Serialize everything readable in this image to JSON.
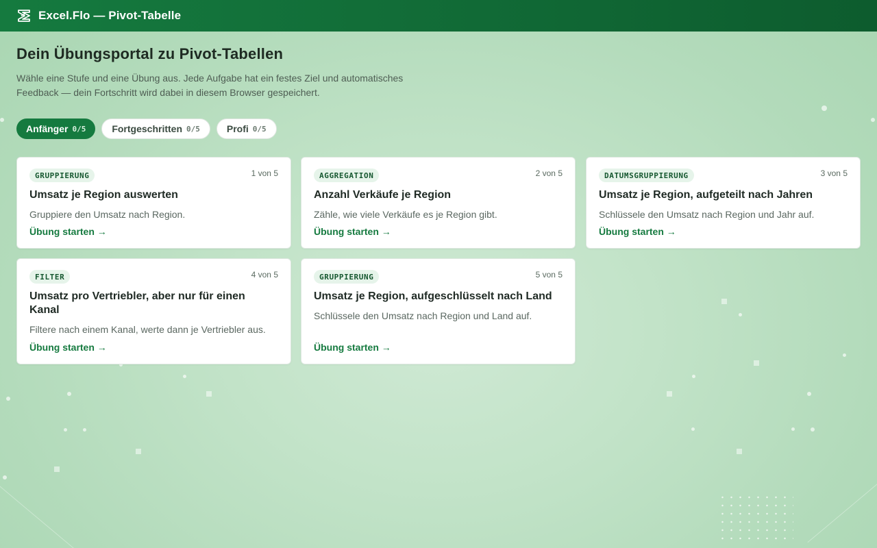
{
  "header": {
    "app_title": "Excel.Flo — Pivot-Tabelle",
    "logo_icon": "leaf-logo-icon"
  },
  "intro": {
    "title": "Dein Übungsportal zu Pivot-Tabellen",
    "description": "Wähle eine Stufe und eine Übung aus. Jede Aufgabe hat ein festes Ziel und automatisches Feedback — dein Fortschritt wird dabei in diesem Browser gespeichert."
  },
  "tabs": [
    {
      "label": "Anfänger",
      "count": "0/5",
      "active": true
    },
    {
      "label": "Fortgeschritten",
      "count": "0/5",
      "active": false
    },
    {
      "label": "Profi",
      "count": "0/5",
      "active": false
    }
  ],
  "exercises": [
    {
      "badge": "GRUPPIERUNG",
      "counter": "1 von 5",
      "title": "Umsatz je Region auswerten",
      "description": "Gruppiere den Umsatz nach Region.",
      "link": "Übung starten →"
    },
    {
      "badge": "AGGREGATION",
      "counter": "2 von 5",
      "title": "Anzahl Verkäufe je Region",
      "description": "Zähle, wie viele Verkäufe es je Region gibt.",
      "link": "Übung starten →"
    },
    {
      "badge": "DATUMSGRUPPIERUNG",
      "counter": "3 von 5",
      "title": "Umsatz je Region, aufgeteilt nach Jahren",
      "description": "Schlüssele den Umsatz nach Region und Jahr auf.",
      "link": "Übung starten →"
    },
    {
      "badge": "FILTER",
      "counter": "4 von 5",
      "title": "Umsatz pro Vertriebler, aber nur für einen Kanal",
      "description": "Filtere nach einem Kanal, werte dann je Vertriebler aus.",
      "link": "Übung starten →"
    },
    {
      "badge": "GRUPPIERUNG",
      "counter": "5 von 5",
      "title": "Umsatz je Region, aufgeschlüsselt nach Land",
      "description": "Schlüssele den Umsatz nach Region und Land auf.",
      "link": "Übung starten →"
    }
  ],
  "colors": {
    "brand": "#157a3f",
    "brand_dark": "#0d5c2e",
    "badge_bg": "#e6f4ea",
    "background": "#c2e3c8"
  }
}
